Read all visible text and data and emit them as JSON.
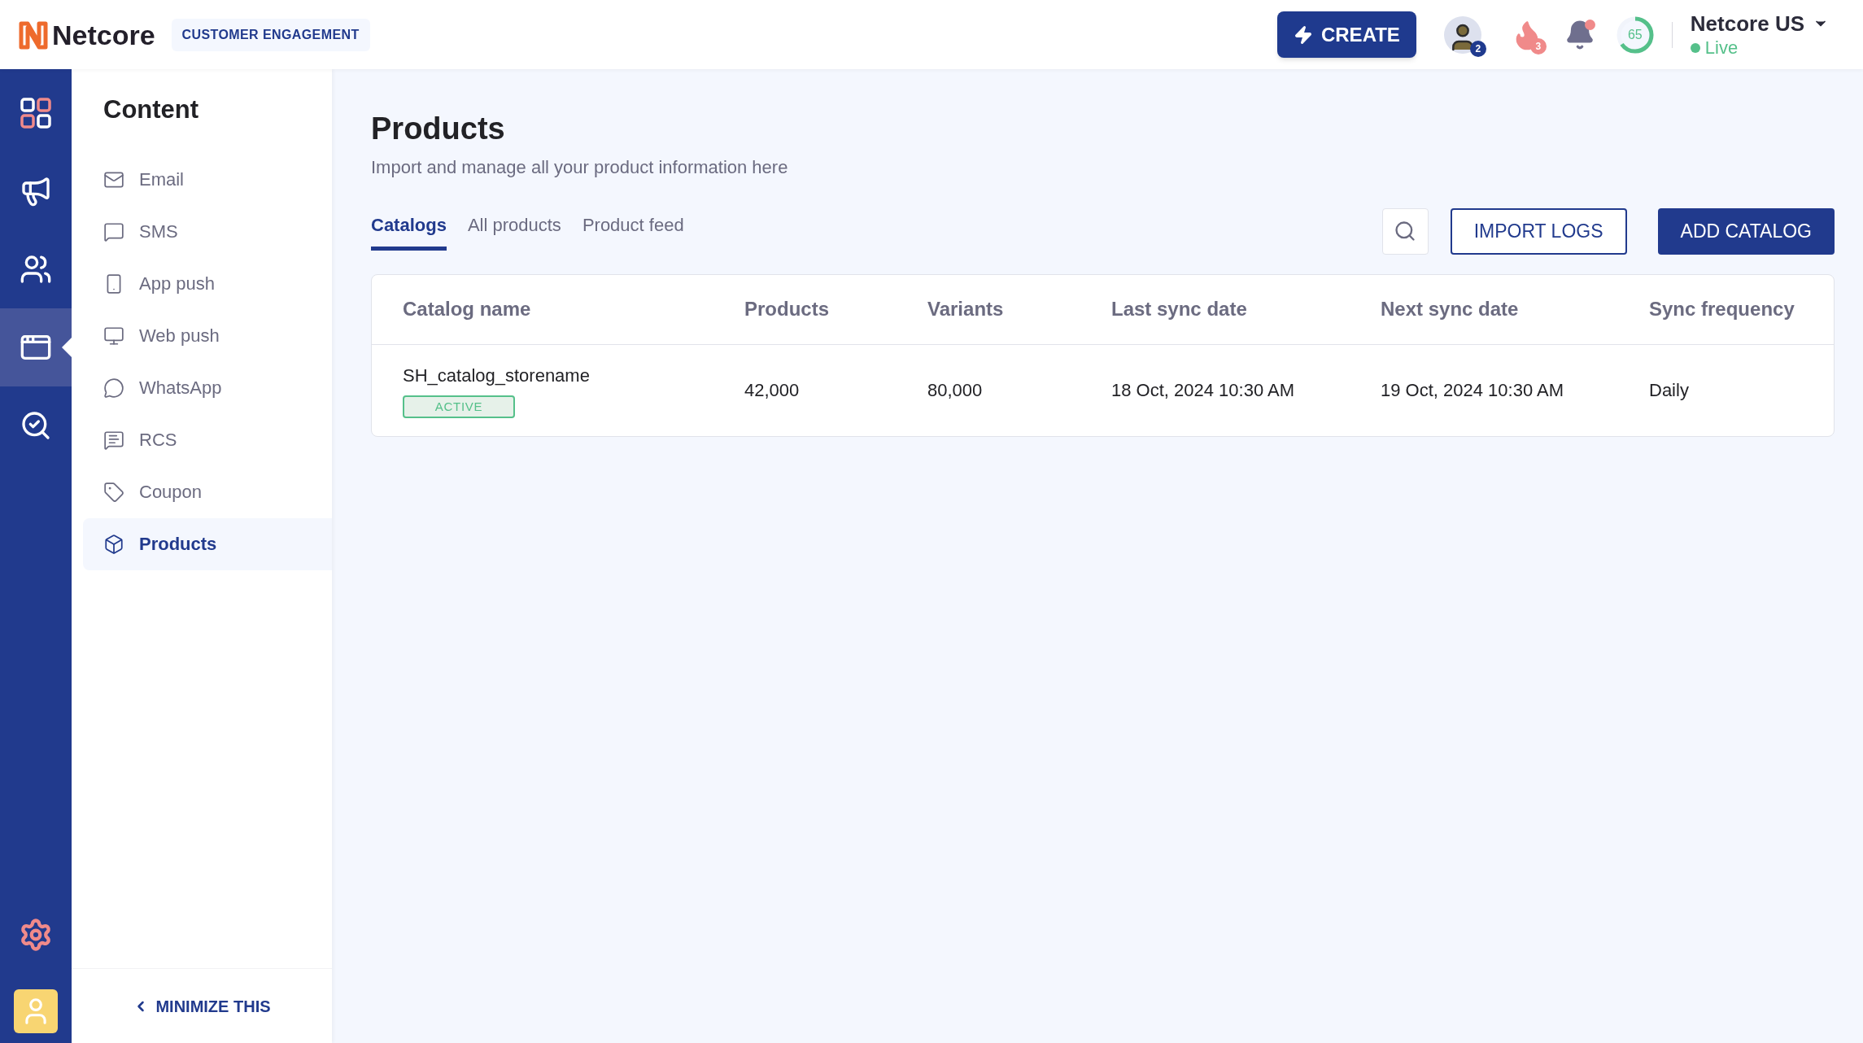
{
  "header": {
    "logo_text": "Netcore",
    "product_badge": "CUSTOMER ENGAGEMENT",
    "create_button": "CREATE",
    "avatar_count": "2",
    "streak_count": "3",
    "notification_dot": true,
    "score": {
      "text": "65",
      "level": 0.65
    },
    "account": {
      "name": "Netcore US",
      "status": "Live"
    }
  },
  "rail": {
    "items": [
      {
        "selected": false
      },
      {
        "selected": false
      },
      {
        "selected": false
      },
      {
        "selected": true
      },
      {
        "selected": false
      }
    ]
  },
  "sidebar": {
    "title": "Content",
    "items": [
      {
        "label": "Email",
        "selected": false
      },
      {
        "label": "SMS",
        "selected": false
      },
      {
        "label": "App push",
        "selected": false
      },
      {
        "label": "Web push",
        "selected": false
      },
      {
        "label": "WhatsApp",
        "selected": false
      },
      {
        "label": "RCS",
        "selected": false
      },
      {
        "label": "Coupon",
        "selected": false
      },
      {
        "label": "Products",
        "selected": true
      }
    ],
    "minimize": "MINIMIZE THIS"
  },
  "page": {
    "title": "Products",
    "subtitle": "Import and manage all your product information here",
    "tabs": [
      {
        "label": "Catalogs",
        "selected": true
      },
      {
        "label": "All products",
        "selected": false
      },
      {
        "label": "Product feed",
        "selected": false
      }
    ],
    "buttons": {
      "secondary": "IMPORT LOGS",
      "primary": "ADD CATALOG"
    },
    "table": {
      "columns": [
        "Catalog name",
        "Products",
        "Variants",
        "Last sync date",
        "Next sync date",
        "Sync frequency"
      ],
      "rows": [
        {
          "cells": [
            "SH_catalog_storename",
            "42,000",
            "80,000",
            "18 Oct, 2024 10:30 AM",
            "19 Oct, 2024 10:30 AM",
            "Daily"
          ],
          "status": "ACTIVE"
        }
      ]
    }
  }
}
